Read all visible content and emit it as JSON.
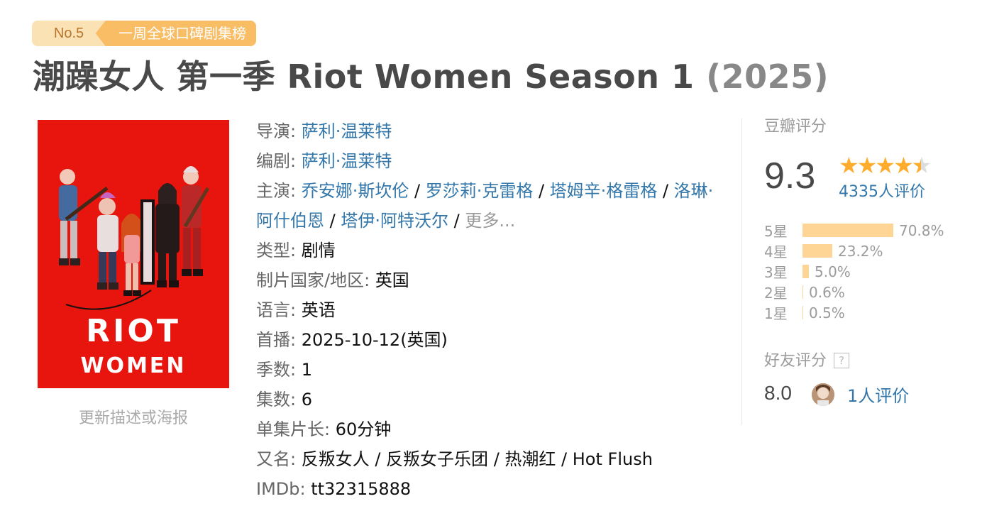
{
  "badge": {
    "rank": "No.5",
    "title": "一周全球口碑剧集榜"
  },
  "title": {
    "name": "潮躁女人 第一季 Riot Women Season 1",
    "year": "(2025)"
  },
  "poster": {
    "update_label": "更新描述或海报",
    "text_line1": "RIOT",
    "text_line2": "WOMEN"
  },
  "info": {
    "director_label": "导演",
    "director": "萨利·温莱特",
    "writer_label": "编剧",
    "writer": "萨利·温莱特",
    "cast_label": "主演",
    "cast": [
      "乔安娜·斯坎伦",
      "罗莎莉·克雷格",
      "塔姆辛·格雷格",
      "洛琳·阿什伯恩",
      "塔伊·阿特沃尔"
    ],
    "cast_more": "更多...",
    "genre_label": "类型",
    "genre": "剧情",
    "country_label": "制片国家/地区",
    "country": "英国",
    "language_label": "语言",
    "language": "英语",
    "premiere_label": "首播",
    "premiere": "2025-10-12(英国)",
    "seasons_label": "季数",
    "seasons": "1",
    "episodes_label": "集数",
    "episodes": "6",
    "runtime_label": "单集片长",
    "runtime": "60分钟",
    "aka_label": "又名",
    "aka": "反叛女人 / 反叛女子乐团 / 热潮红 / Hot Flush",
    "imdb_label": "IMDb",
    "imdb": "tt32315888"
  },
  "rating": {
    "label": "豆瓣评分",
    "score": "9.3",
    "stars": 4.5,
    "votes": "4335人评价",
    "breakdown": [
      {
        "label": "5星",
        "percent": "70.8%",
        "value": 70.8
      },
      {
        "label": "4星",
        "percent": "23.2%",
        "value": 23.2
      },
      {
        "label": "3星",
        "percent": "5.0%",
        "value": 5.0
      },
      {
        "label": "2星",
        "percent": "0.6%",
        "value": 0.6
      },
      {
        "label": "1星",
        "percent": "0.5%",
        "value": 0.5
      }
    ],
    "friends_label": "好友评分",
    "friends_help": "?",
    "friends_score": "8.0",
    "friends_votes": "1人评价"
  },
  "colors": {
    "link": "#3377aa",
    "star": "#ffac2d",
    "bar": "#ffd596",
    "poster_bg": "#e8150e"
  }
}
